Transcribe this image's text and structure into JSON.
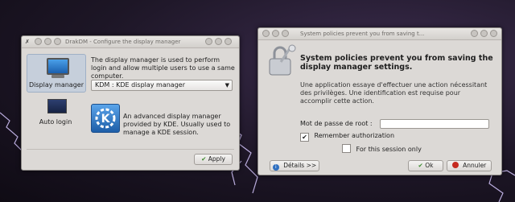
{
  "drakdm": {
    "title": "DrakDM - Configure the display manager",
    "sidebar": [
      {
        "label": "Display manager",
        "icon": "monitor-icon"
      },
      {
        "label": "Auto login",
        "icon": "autologin-screen-icon"
      }
    ],
    "description": "The display manager is used to perform login and allow multiple users to use a same computer.",
    "select_value": "KDM : KDE display manager",
    "kde_icon": "kde-logo-icon",
    "kde_description": "An advanced display manager provided by KDE. Usually used to manage a KDE session.",
    "apply_label": "Apply",
    "apply_icon": "checkmark-icon"
  },
  "policy": {
    "title": "System policies prevent you from saving t...",
    "heading": "System policies prevent you from saving the display manager settings.",
    "lock_icon": "lock-keys-icon",
    "message": "Une application essaye d'effectuer une action nécessitant des privilèges. Une identification est requise pour accomplir cette action.",
    "password_label": "Mot de passe de root :",
    "password_value": "",
    "remember_label": "Remember authorization",
    "remember_checked": true,
    "session_label": "For this session only",
    "session_checked": false,
    "details_label": "Détails >>",
    "ok_label": "Ok",
    "cancel_label": "Annuler"
  },
  "colors": {
    "accent": "#2f6fc0",
    "ok_icon": "#3c8a2e",
    "cancel_icon": "#c52a20"
  }
}
